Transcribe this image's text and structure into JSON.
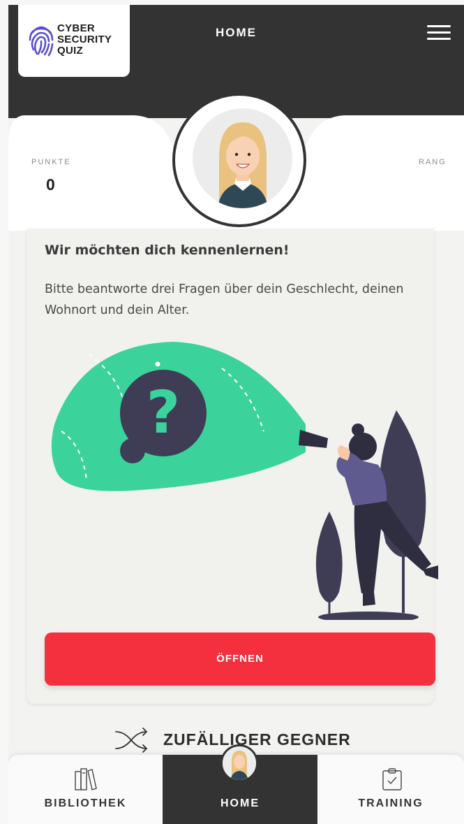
{
  "header": {
    "logo_lines": [
      "CYBER",
      "SECURITY",
      "QUIZ"
    ],
    "title": "HOME",
    "menu_icon": "hamburger-menu-icon"
  },
  "stats": {
    "points_label": "PUNKTE",
    "points_value": "0",
    "rank_label": "RANG"
  },
  "card": {
    "title": "Wir möchten dich kennenlernen!",
    "text": "Bitte beantworte drei Fragen über dein Geschlecht, deinen Wohnort und dein Alter.",
    "button_label": "ÖFFNEN"
  },
  "random_opponent": {
    "label": "ZUFÄLLIGER GEGNER",
    "icon": "shuffle-icon"
  },
  "bottom_nav": {
    "items": [
      {
        "label": "BIBLIOTHEK",
        "icon": "books-icon"
      },
      {
        "label": "HOME",
        "icon": "avatar"
      },
      {
        "label": "TRAINING",
        "icon": "clipboard-check-icon"
      }
    ]
  },
  "colors": {
    "header_bg": "#333333",
    "accent_red": "#f4303f",
    "illustration_green": "#3bd39b",
    "illustration_dark": "#3f3d56",
    "logo_purple": "#5a4fcf"
  }
}
